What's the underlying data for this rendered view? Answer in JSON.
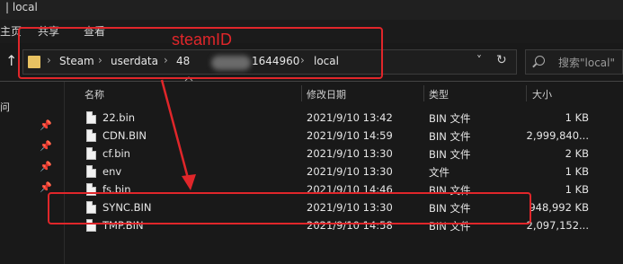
{
  "window": {
    "title": "| local"
  },
  "ribbon": {
    "tabs": [
      "共享",
      "查看"
    ],
    "left_cut": "主页"
  },
  "address": {
    "crumbs": [
      "Steam",
      "userdata",
      "48",
      "1644960",
      "local"
    ],
    "separators": [
      "›",
      "›",
      "›",
      "›"
    ],
    "dropdown": "˅",
    "refresh": "↻"
  },
  "search": {
    "placeholder": "搜索\"local\""
  },
  "sidebar": {
    "label_cut": "问"
  },
  "columns": {
    "name": "名称",
    "modified": "修改日期",
    "type": "类型",
    "size": "大小"
  },
  "files": [
    {
      "name": "22.bin",
      "modified": "2021/9/10 13:42",
      "type": "BIN 文件",
      "size": "1 KB"
    },
    {
      "name": "CDN.BIN",
      "modified": "2021/9/10 14:59",
      "type": "BIN 文件",
      "size": "2,999,840..."
    },
    {
      "name": "cf.bin",
      "modified": "2021/9/10 13:30",
      "type": "BIN 文件",
      "size": "2 KB"
    },
    {
      "name": "env",
      "modified": "2021/9/10 13:30",
      "type": "文件",
      "size": "1 KB"
    },
    {
      "name": "fs.bin",
      "modified": "2021/9/10 14:46",
      "type": "BIN 文件",
      "size": "1 KB"
    },
    {
      "name": "SYNC.BIN",
      "modified": "2021/9/10 13:30",
      "type": "BIN 文件",
      "size": "948,992 KB"
    },
    {
      "name": "TMP.BIN",
      "modified": "2021/9/10 14:58",
      "type": "BIN 文件",
      "size": "2,097,152..."
    }
  ],
  "annotation": {
    "label": "steamID",
    "color": "#e0262a"
  }
}
